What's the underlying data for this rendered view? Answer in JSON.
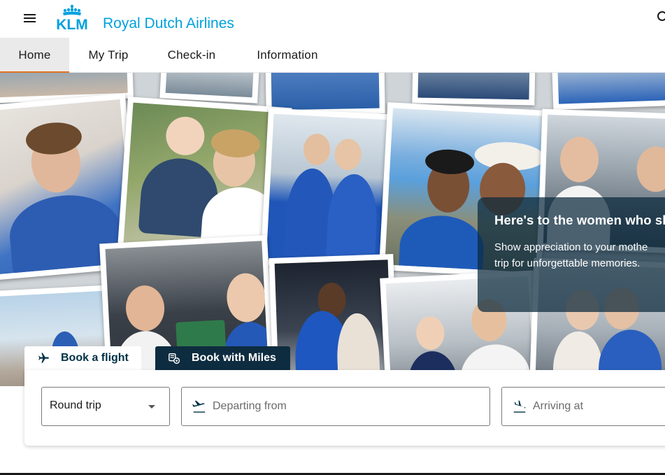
{
  "header": {
    "logo_text": "KLM",
    "brand_name": "Royal Dutch Airlines"
  },
  "nav": {
    "items": [
      {
        "label": "Home",
        "active": true
      },
      {
        "label": "My Trip"
      },
      {
        "label": "Check-in"
      },
      {
        "label": "Information"
      }
    ]
  },
  "promo": {
    "title": "Here's to the women who sh",
    "text_line1": "Show appreciation to your mothe",
    "text_line2": "trip for unforgettable memories."
  },
  "booking": {
    "tabs": [
      {
        "label": "Book a flight",
        "active": true,
        "icon": "plane-icon"
      },
      {
        "label": "Book with Miles",
        "icon": "miles-coins-icon"
      }
    ],
    "trip_type": "Round trip",
    "departing_placeholder": "Departing from",
    "arriving_placeholder": "Arriving at"
  },
  "colors": {
    "brand_blue": "#00a1de",
    "dark_navy": "#0e2c40",
    "accent_orange": "#e37222"
  }
}
